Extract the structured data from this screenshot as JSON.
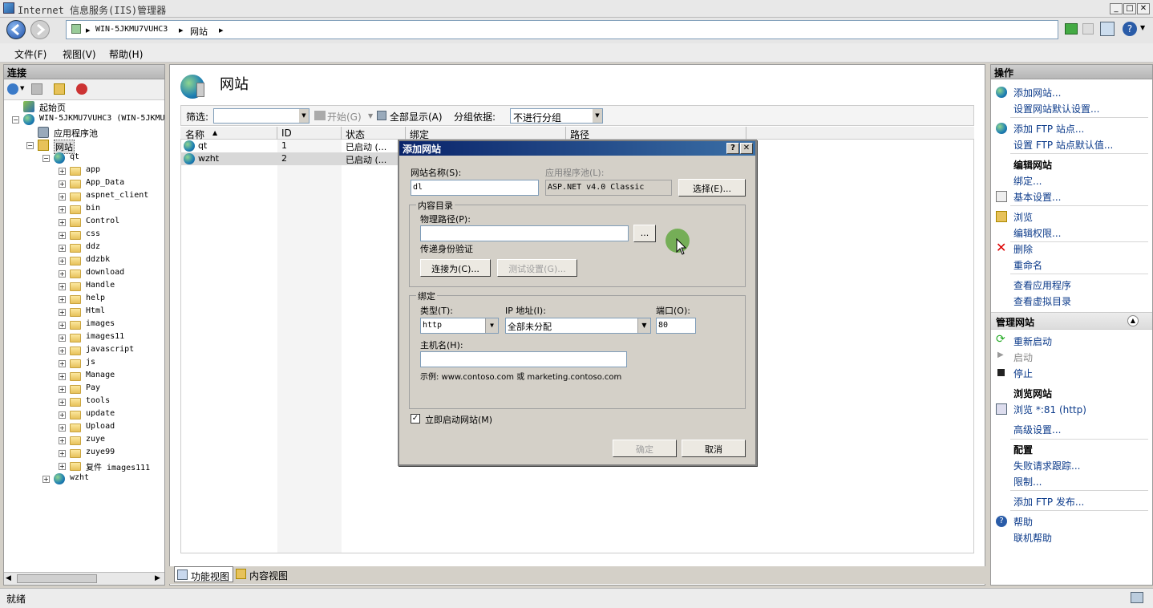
{
  "window": {
    "title": "Internet 信息服务(IIS)管理器"
  },
  "address": {
    "server": "WIN-5JKMU7VUHC3",
    "node": "网站"
  },
  "menu": {
    "file": "文件(F)",
    "view": "视图(V)",
    "help": "帮助(H)"
  },
  "left": {
    "header": "连接",
    "tree": {
      "start": "起始页",
      "server": "WIN-5JKMU7VUHC3 (WIN-5JKMU",
      "apppools": "应用程序池",
      "sites": "网站",
      "site_qt": "qt",
      "folders": [
        "app",
        "App_Data",
        "aspnet_client",
        "bin",
        "Control",
        "css",
        "ddz",
        "ddzbk",
        "download",
        "Handle",
        "help",
        "Html",
        "images",
        "images11",
        "javascript",
        "js",
        "Manage",
        "Pay",
        "tools",
        "update",
        "Upload",
        "zuye",
        "zuye99",
        "复件 images111"
      ],
      "site_wzht": "wzht"
    }
  },
  "center": {
    "title": "网站",
    "filter": {
      "label": "筛选:",
      "start": "开始(G)",
      "showall": "全部显示(A)",
      "groupby": "分组依据:",
      "groupval": "不进行分组"
    },
    "columns": [
      "名称",
      "ID",
      "状态",
      "绑定",
      "路径"
    ],
    "rows": [
      {
        "name": "qt",
        "id": "1",
        "status": "已启动 (..."
      },
      {
        "name": "wzht",
        "id": "2",
        "status": "已启动 (..."
      }
    ],
    "tabs": {
      "features": "功能视图",
      "content": "内容视图"
    }
  },
  "right": {
    "header": "操作",
    "actions": {
      "add_site": "添加网站...",
      "site_defaults": "设置网站默认设置...",
      "add_ftp": "添加 FTP 站点...",
      "ftp_defaults": "设置 FTP 站点默认值...",
      "edit_site": "编辑网站",
      "bindings": "绑定...",
      "basic": "基本设置...",
      "browse": "浏览",
      "perms": "编辑权限...",
      "delete": "删除",
      "rename": "重命名",
      "view_apps": "查看应用程序",
      "view_vdirs": "查看虚拟目录",
      "manage": "管理网站",
      "restart": "重新启动",
      "start": "启动",
      "stop": "停止",
      "browse_site": "浏览网站",
      "browse_81": "浏览 *:81 (http)",
      "advanced": "高级设置...",
      "config": "配置",
      "failed_req": "失败请求跟踪...",
      "limits": "限制...",
      "add_ftp_pub": "添加 FTP 发布...",
      "help": "帮助",
      "online_help": "联机帮助"
    }
  },
  "status": {
    "text": "就绪"
  },
  "dialog": {
    "title": "添加网站",
    "site_name_label": "网站名称(S):",
    "site_name": "dl",
    "app_pool_label": "应用程序池(L):",
    "app_pool": "ASP.NET v4.0 Classic",
    "select_btn": "选择(E)...",
    "content_dir": "内容目录",
    "phys_path_label": "物理路径(P):",
    "phys_path": "",
    "browse_btn": "...",
    "pass_auth": "传递身份验证",
    "connect_as": "连接为(C)...",
    "test_settings": "测试设置(G)...",
    "binding": "绑定",
    "type_label": "类型(T):",
    "type": "http",
    "ip_label": "IP 地址(I):",
    "ip": "全部未分配",
    "port_label": "端口(O):",
    "port": "80",
    "host_label": "主机名(H):",
    "host": "",
    "example": "示例: www.contoso.com 或 marketing.contoso.com",
    "autostart": "立即启动网站(M)",
    "ok": "确定",
    "cancel": "取消"
  }
}
